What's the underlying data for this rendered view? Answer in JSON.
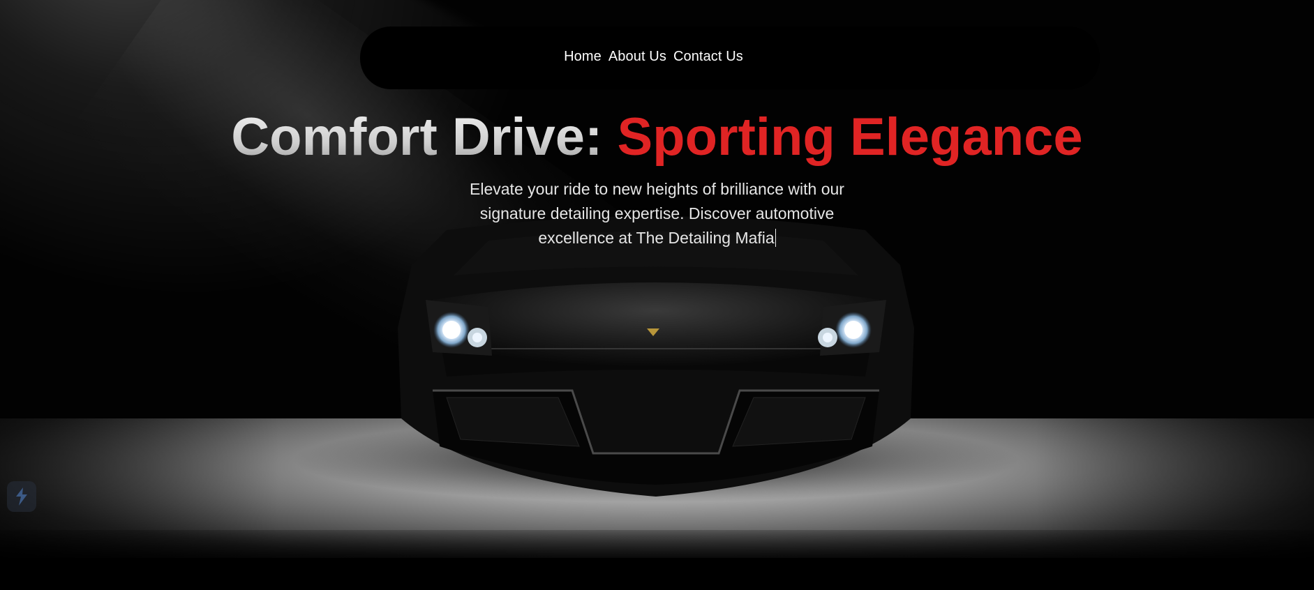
{
  "nav": {
    "items": [
      {
        "label": "Home"
      },
      {
        "label": "About Us"
      },
      {
        "label": "Contact Us"
      }
    ]
  },
  "hero": {
    "headline_plain": "Comfort Drive:",
    "headline_accent": "Sporting Elegance",
    "subtitle_lines": [
      "Elevate your ride to new heights of brilliance with our",
      "signature detailing expertise. Discover automotive",
      "excellence at The Detailing Mafia"
    ]
  },
  "colors": {
    "background": "#000000",
    "accent": "#e02424",
    "text": "#ffffff"
  },
  "icons": {
    "floating_widget": "bolt-logo-icon"
  }
}
